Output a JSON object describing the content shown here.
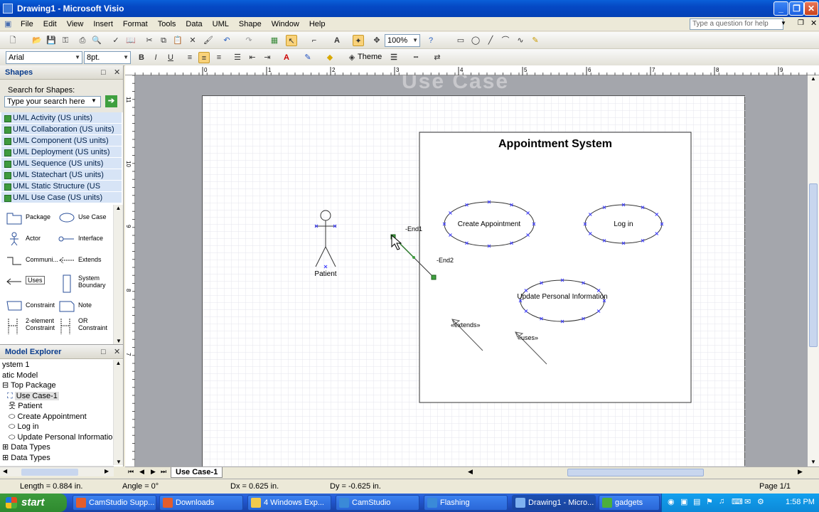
{
  "window": {
    "title": "Drawing1 - Microsoft Visio"
  },
  "menu": {
    "items": [
      "File",
      "Edit",
      "View",
      "Insert",
      "Format",
      "Tools",
      "Data",
      "UML",
      "Shape",
      "Window",
      "Help"
    ],
    "help_placeholder": "Type a question for help"
  },
  "toolbar": {
    "zoom": "100%",
    "font": "Arial",
    "font_size": "8pt.",
    "theme_label": "Theme"
  },
  "shapes_pane": {
    "title": "Shapes",
    "search_label": "Search for Shapes:",
    "search_placeholder": "Type your search here",
    "stencils": [
      "UML Activity (US units)",
      "UML Collaboration (US units)",
      "UML Component (US units)",
      "UML Deployment (US units)",
      "UML Sequence (US units)",
      "UML Statechart (US units)",
      "UML Static Structure (US units)",
      "UML Use Case (US units)"
    ],
    "shapes": [
      "Package",
      "Use Case",
      "Actor",
      "Interface",
      "Communi...",
      "Extends",
      "Uses",
      "System Boundary",
      "Constraint",
      "Note",
      "2-element Constraint",
      "OR Constraint"
    ]
  },
  "model_explorer": {
    "title": "Model Explorer",
    "items": [
      "ystem 1",
      "atic Model",
      "Top Package",
      "Use Case-1",
      "Patient",
      "Create Appointment",
      "Log in",
      "Update Personal Information",
      "Data Types",
      "Data Types"
    ]
  },
  "diagram": {
    "background_text": "Use Case",
    "system_title": "Appointment System",
    "actor": "Patient",
    "use_cases": [
      "Create Appointment",
      "Log in",
      "Update Personal Information"
    ],
    "connector_labels": [
      "-End1",
      "-End2"
    ],
    "stereotypes": [
      "«extends»",
      "«uses»"
    ]
  },
  "ruler_h": [
    "0",
    "1",
    "2",
    "3",
    "4",
    "5",
    "6",
    "7",
    "8",
    "9"
  ],
  "ruler_v": [
    "11",
    "10",
    "9",
    "8",
    "7"
  ],
  "page_tab": "Use Case-1",
  "status": {
    "length": "Length = 0.884 in.",
    "angle": "Angle = 0°",
    "dx": "Dx = 0.625 in.",
    "dy": "Dy = -0.625 in.",
    "page": "Page 1/1"
  },
  "taskbar": {
    "start": "start",
    "tasks": [
      "CamStudio Supp...",
      "Downloads",
      "4 Windows Exp...",
      "CamStudio",
      "Flashing",
      "Drawing1 - Micro...",
      "gadgets"
    ],
    "clock": "1:58 PM"
  },
  "colors": {
    "titlebar": "#0548c4",
    "stencil_bg": "#d7e4f6",
    "shape_handle": "#3c3cff",
    "connector": "#2d7a2d"
  }
}
